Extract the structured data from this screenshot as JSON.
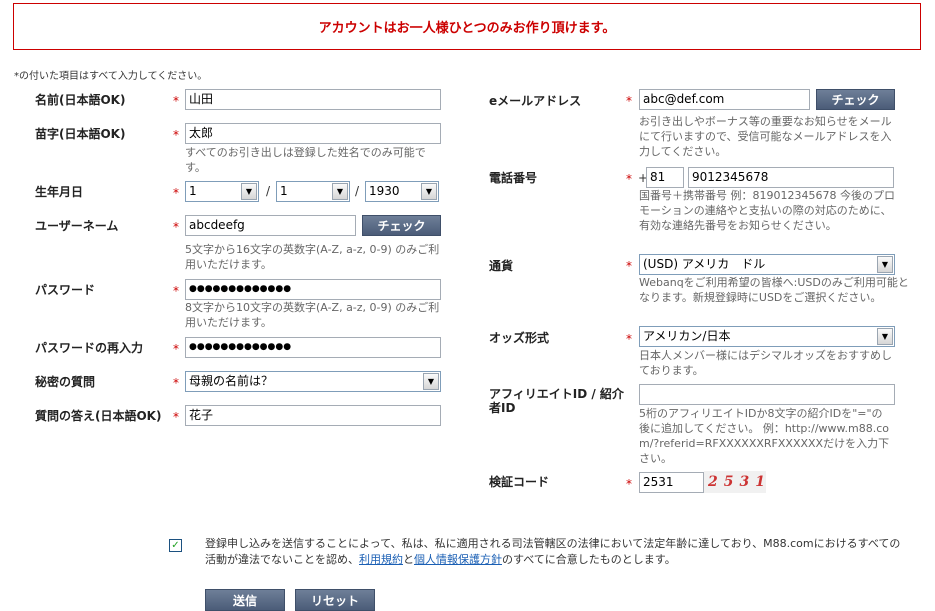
{
  "notice": "アカウントはお一人様ひとつのみお作り頂けます。",
  "required_note": "*の付いた項目はすべて入力してください。",
  "star": "*",
  "left": {
    "first_name": {
      "label": "名前(日本語OK)",
      "value": "山田"
    },
    "last_name": {
      "label": "苗字(日本語OK)",
      "value": "太郎",
      "hint": "すべてのお引き出しは登録した姓名でのみ可能です。"
    },
    "birthdate": {
      "label": "生年月日",
      "day": "1",
      "month": "1",
      "year": "1930",
      "sep": "/"
    },
    "username": {
      "label": "ユーザーネーム",
      "value": "abcdeefg",
      "check_button": "チェック",
      "hint": "5文字から16文字の英数字(A-Z, a-z, 0-9) のみご利用いただけます。"
    },
    "password": {
      "label": "パスワード",
      "value": "●●●●●●●●●●●●●",
      "hint": "8文字から10文字の英数字(A-Z, a-z, 0-9) のみご利用いただけます。"
    },
    "password_confirm": {
      "label": "パスワードの再入力",
      "value": "●●●●●●●●●●●●●"
    },
    "security_question": {
      "label": "秘密の質問",
      "value": "母親の名前は？"
    },
    "security_answer": {
      "label": "質問の答え(日本語OK)",
      "value": "花子"
    }
  },
  "right": {
    "email": {
      "label": "eメールアドレス",
      "value": "abc@def.com",
      "check_button": "チェック",
      "hint": "お引き出しやボーナス等の重要なお知らせをメールにて行いますので、受信可能なメールアドレスを入力してください。"
    },
    "phone": {
      "label": "電話番号",
      "plus": "+",
      "country_code": "81",
      "number": "9012345678",
      "hint": "国番号＋携帯番号 例：819012345678 今後のプロモーションの連絡やと支払いの際の対応のために、有効な連絡先番号をお知らせください。"
    },
    "currency": {
      "label": "通貨",
      "value": "(USD) アメリカ　ドル",
      "hint": "Webanqをご利用希望の皆様へ:USDのみご利用可能となります。新規登録時にUSDをご選択ください。"
    },
    "odds_format": {
      "label": "オッズ形式",
      "value": "アメリカン/日本",
      "hint": "日本人メンバー様にはデシマルオッズをおすすめしております。"
    },
    "affiliate": {
      "label": "アフィリエイトID / 紹介者ID",
      "value": "",
      "hint": "5桁のアフィリエイトIDか8文字の紹介IDを\"=\"の後に追加してください。 例：http://www.m88.com/?referid=RFXXXXXXRFXXXXXXだけを入力下さい。"
    },
    "captcha": {
      "label": "検証コード",
      "value": "2531",
      "image_text": "2531"
    }
  },
  "agreement": {
    "checked": true,
    "text_before": "登録申し込みを送信することによって、私は、私に適用される司法管轄区の法律において法定年齢に達しており、M88.comにおけるすべての活動が違法でないことを認め、",
    "terms_link": "利用規約",
    "text_and": "と",
    "privacy_link": "個人情報保護方針",
    "text_after": "のすべてに合意したものとします。"
  },
  "buttons": {
    "submit": "送信",
    "reset": "リセット"
  }
}
